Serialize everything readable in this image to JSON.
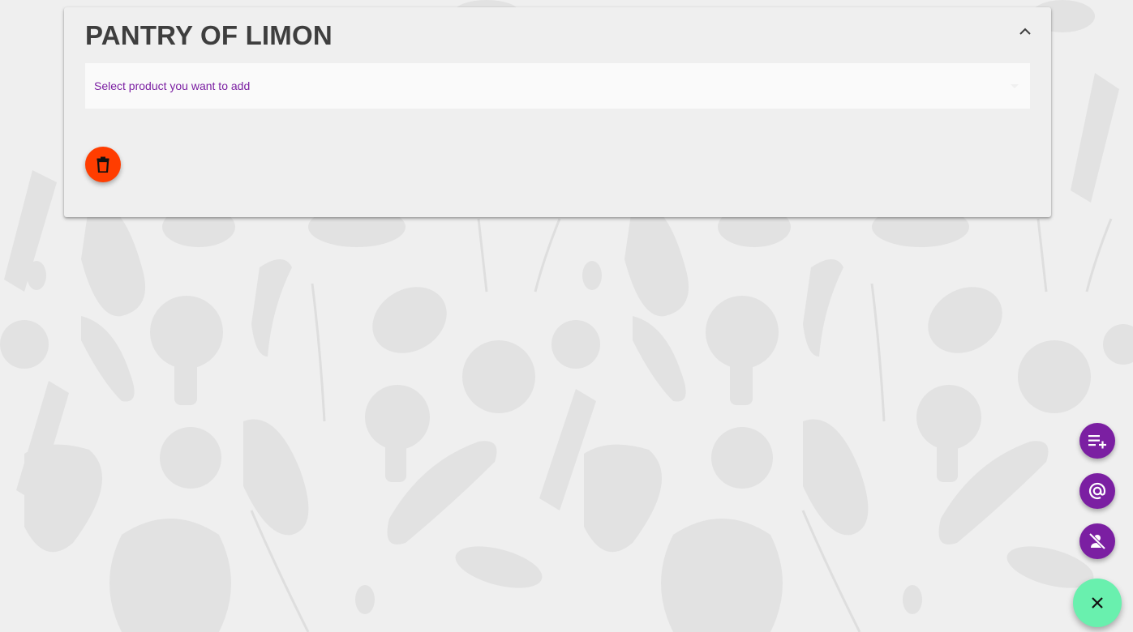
{
  "pantry": {
    "title": "PANTRY OF LIMON",
    "select_placeholder": "Select product you want to add"
  },
  "icons": {
    "collapse": "chevron-up-icon",
    "delete": "delete-icon",
    "add_list": "playlist-add-icon",
    "email": "alternate-email-icon",
    "person_off": "person-off-icon",
    "close": "close-icon"
  },
  "colors": {
    "accent_purple": "#7b1fa2",
    "delete_red": "#ff3d00",
    "fab_green": "#69f0ae",
    "title_gray": "#3e3e3e",
    "background": "#efefef"
  }
}
